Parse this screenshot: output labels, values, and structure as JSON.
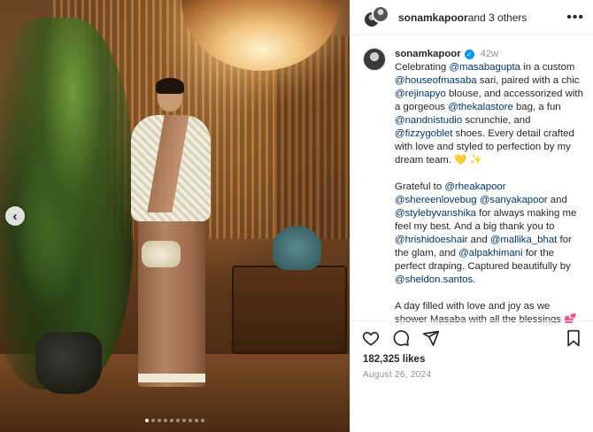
{
  "photo": {
    "carousel_count": 10,
    "active_index": 0
  },
  "header": {
    "username": "sonamkapoor",
    "others_text": " and 3 others",
    "more_label": "•••"
  },
  "caption": {
    "username": "sonamkapoor",
    "verified_glyph": "✓",
    "time": "42w",
    "p1": [
      {
        "t": "Celebrating "
      },
      {
        "t": "@masabagupta",
        "m": true
      },
      {
        "t": " in a custom "
      },
      {
        "t": "@houseofmasaba",
        "m": true
      },
      {
        "t": " sari, paired with a chic "
      },
      {
        "t": "@rejinapyo",
        "m": true
      },
      {
        "t": " blouse, and accessorized with a gorgeous "
      },
      {
        "t": "@thekalastore",
        "m": true
      },
      {
        "t": " bag, a fun "
      },
      {
        "t": "@nandnistudio",
        "m": true
      },
      {
        "t": " scrunchie, and "
      },
      {
        "t": "@fizzygoblet",
        "m": true
      },
      {
        "t": " shoes. Every detail crafted with love and styled to perfection by my dream team. 💛 ✨"
      }
    ],
    "p2": [
      {
        "t": "Grateful to "
      },
      {
        "t": "@rheakapoor",
        "m": true
      },
      {
        "t": " "
      },
      {
        "t": "@shereenlovebug",
        "m": true
      },
      {
        "t": " "
      },
      {
        "t": "@sanyakapoor",
        "m": true
      },
      {
        "t": " and "
      },
      {
        "t": "@stylebyvanshika",
        "m": true
      },
      {
        "t": " for always making me feel my best. And a big thank you to "
      },
      {
        "t": "@hrishidoeshair",
        "m": true
      },
      {
        "t": " and "
      },
      {
        "t": "@mallika_bhat",
        "m": true
      },
      {
        "t": " for the glam, and "
      },
      {
        "t": "@alpakhimani",
        "m": true
      },
      {
        "t": " for the perfect draping. Captured beautifully by "
      },
      {
        "t": "@sheldon.santos",
        "m": true
      },
      {
        "t": "."
      }
    ],
    "p3": [
      {
        "t": "A day filled with love and joy as we shower Masaba with all the blessings 💕"
      }
    ]
  },
  "actions": {
    "like_icon": "heart-icon",
    "comment_icon": "comment-icon",
    "share_icon": "send-icon",
    "save_icon": "bookmark-icon"
  },
  "likes": "182,325 likes",
  "date": "August 26, 2024"
}
